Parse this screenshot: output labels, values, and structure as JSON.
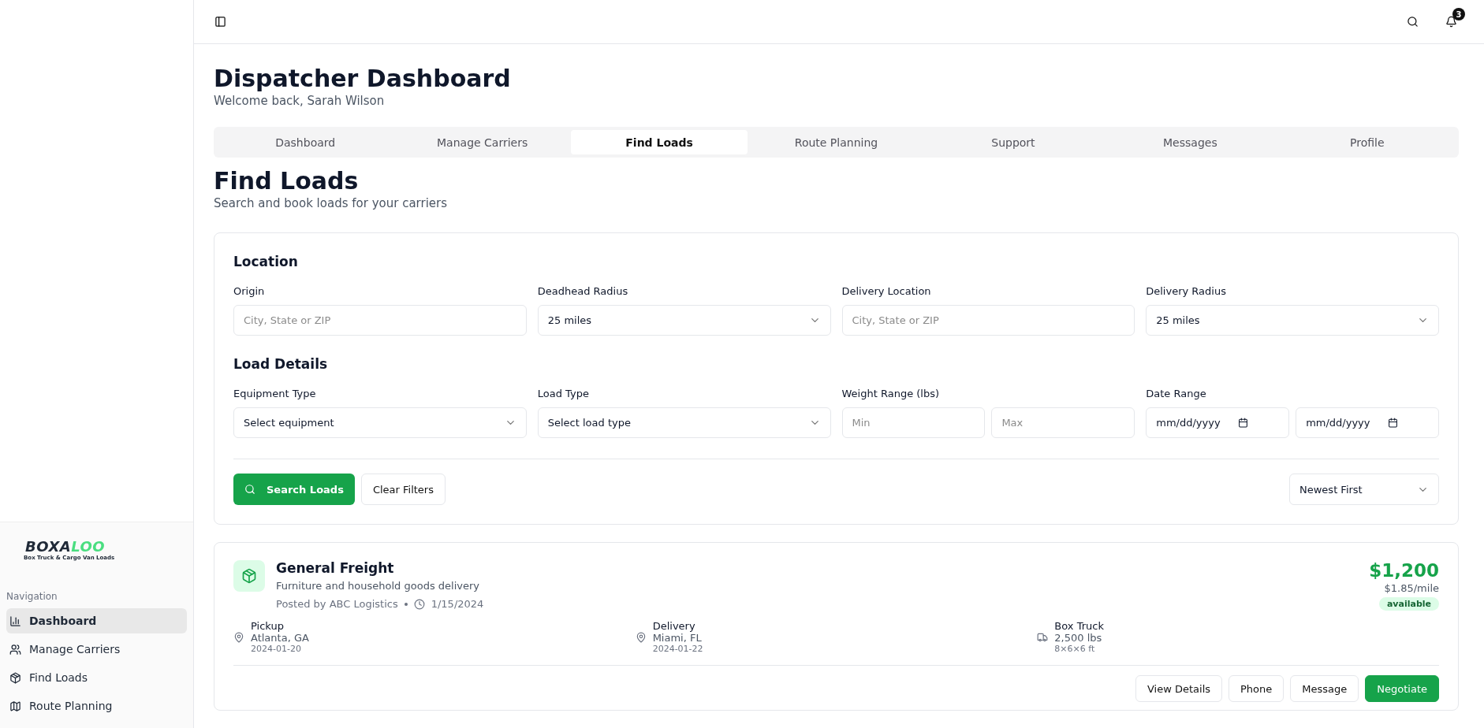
{
  "topbar": {
    "notification_count": "3"
  },
  "sidebar": {
    "logo": {
      "brand_a": "BOXA",
      "brand_b": "LOO",
      "tagline": "Box Truck & Cargo Van Loads"
    },
    "section": "Navigation",
    "items": [
      {
        "label": "Dashboard",
        "selected": true
      },
      {
        "label": "Manage Carriers",
        "selected": false
      },
      {
        "label": "Find Loads",
        "selected": false
      },
      {
        "label": "Route Planning",
        "selected": false
      }
    ]
  },
  "header": {
    "title": "Dispatcher Dashboard",
    "subtitle": "Welcome back, Sarah Wilson"
  },
  "tabs": [
    {
      "label": "Dashboard",
      "selected": false
    },
    {
      "label": "Manage Carriers",
      "selected": false
    },
    {
      "label": "Find Loads",
      "selected": true
    },
    {
      "label": "Route Planning",
      "selected": false
    },
    {
      "label": "Support",
      "selected": false
    },
    {
      "label": "Messages",
      "selected": false
    },
    {
      "label": "Profile",
      "selected": false
    }
  ],
  "page": {
    "title": "Find Loads",
    "subtitle": "Search and book loads for your carriers"
  },
  "filters": {
    "sections": [
      {
        "title": "Location",
        "fields": [
          {
            "label": "Origin",
            "kind": "text",
            "placeholder": "City, State or ZIP"
          },
          {
            "label": "Deadhead Radius",
            "kind": "select",
            "value": "25 miles"
          },
          {
            "label": "Delivery Location",
            "kind": "text",
            "placeholder": "City, State or ZIP"
          },
          {
            "label": "Delivery Radius",
            "kind": "select",
            "value": "25 miles"
          }
        ]
      },
      {
        "title": "Load Details",
        "fields": [
          {
            "label": "Equipment Type",
            "kind": "select",
            "value": "Select equipment"
          },
          {
            "label": "Load Type",
            "kind": "select",
            "value": "Select load type"
          },
          {
            "label": "Weight Range (lbs)",
            "kind": "pair",
            "placeholders": [
              "Min",
              "Max"
            ]
          },
          {
            "label": "Date Range",
            "kind": "dates",
            "placeholders": [
              "mm/dd/yyyy",
              "mm/dd/yyyy"
            ]
          }
        ]
      }
    ],
    "search_button": "Search Loads",
    "clear_button": "Clear Filters",
    "sort": "Newest First"
  },
  "loads": [
    {
      "title": "General Freight",
      "description": "Furniture and household goods delivery",
      "posted_by": "Posted by ABC Logistics",
      "posted_date": "1/15/2024",
      "price": "$1,200",
      "rate": "$1.85/mile",
      "status": "available",
      "pickup": {
        "label": "Pickup",
        "place": "Atlanta, GA",
        "date": "2024-01-20"
      },
      "delivery": {
        "label": "Delivery",
        "place": "Miami, FL",
        "date": "2024-01-22"
      },
      "equipment": {
        "label": "Box Truck",
        "weight": "2,500 lbs",
        "size": "8×6×6 ft"
      },
      "actions": [
        {
          "label": "View Details",
          "kind": "outline"
        },
        {
          "label": "Phone",
          "kind": "outline"
        },
        {
          "label": "Message",
          "kind": "outline"
        },
        {
          "label": "Negotiate",
          "kind": "primary"
        }
      ]
    }
  ]
}
